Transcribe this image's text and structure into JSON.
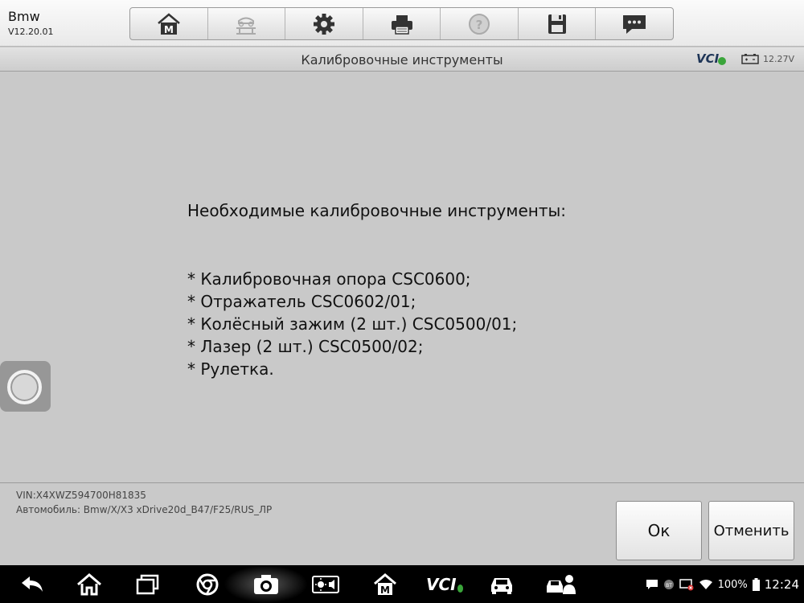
{
  "app": {
    "name": "Bmw",
    "version": "V12.20.01"
  },
  "toolbar": {
    "items": [
      {
        "name": "home-m-icon"
      },
      {
        "name": "car-lift-icon"
      },
      {
        "name": "gear-icon"
      },
      {
        "name": "printer-icon"
      },
      {
        "name": "help-icon"
      },
      {
        "name": "save-icon"
      },
      {
        "name": "chat-icon"
      }
    ]
  },
  "titlebar": {
    "title": "Калибровочные инструменты",
    "vci": "VCI",
    "voltage": "12.27V"
  },
  "content": {
    "heading": "Необходимые калибровочные инструменты:",
    "items": [
      "* Калибровочная опора CSC0600;",
      "* Отражатель CSC0602/01;",
      "* Колёсный зажим (2 шт.) CSC0500/01;",
      "* Лазер (2 шт.) CSC0500/02;",
      "* Рулетка."
    ]
  },
  "footer": {
    "vin": "VIN:X4XWZ594700H81835",
    "car": "Автомобиль: Bmw/X/X3 xDrive20d_B47/F25/RUS_ЛР",
    "ok_label": "Ок",
    "cancel_label": "Отменить"
  },
  "navbar": {
    "vci": "VCI",
    "battery_pct": "100%",
    "time": "12:24"
  },
  "colors": {
    "vci_ok": "#3aa53a",
    "navbar_bg": "#000000",
    "content_bg": "#c9c9c9"
  }
}
